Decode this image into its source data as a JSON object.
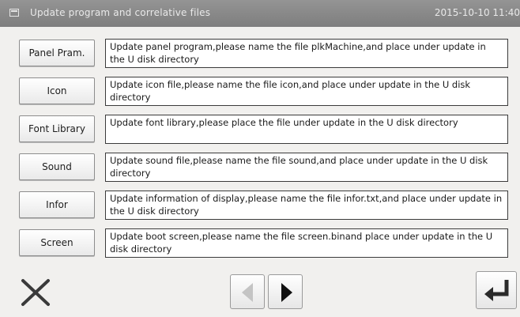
{
  "window": {
    "title": "Update program and correlative files",
    "clock": "2015-10-10 11:40"
  },
  "items": [
    {
      "label": "Panel Pram.",
      "description": "Update panel program,please name the file plkMachine,and place under update in the U disk directory"
    },
    {
      "label": "Icon",
      "description": "Update icon file,please name the file icon,and place under update in the U disk directory"
    },
    {
      "label": "Font Library",
      "description": "Update font library,please place the file under update in the U disk directory"
    },
    {
      "label": "Sound",
      "description": "Update sound file,please name the file sound,and place under update in the U disk directory"
    },
    {
      "label": "Infor",
      "description": "Update information of display,please name the file infor.txt,and place under update in the U disk directory"
    },
    {
      "label": "Screen",
      "description": "Update boot screen,please name the file screen.binand place under update in the U disk directory"
    }
  ],
  "footer": {
    "close_icon": "close-x-icon",
    "prev_icon": "arrow-left-icon",
    "next_icon": "arrow-right-icon",
    "enter_icon": "enter-return-icon"
  },
  "colors": {
    "titlebar": "#8a8a8a",
    "background": "#f1f0ee",
    "enter_arrow": "#2a2a2a",
    "disabled_arrow": "#c4c4c4"
  }
}
